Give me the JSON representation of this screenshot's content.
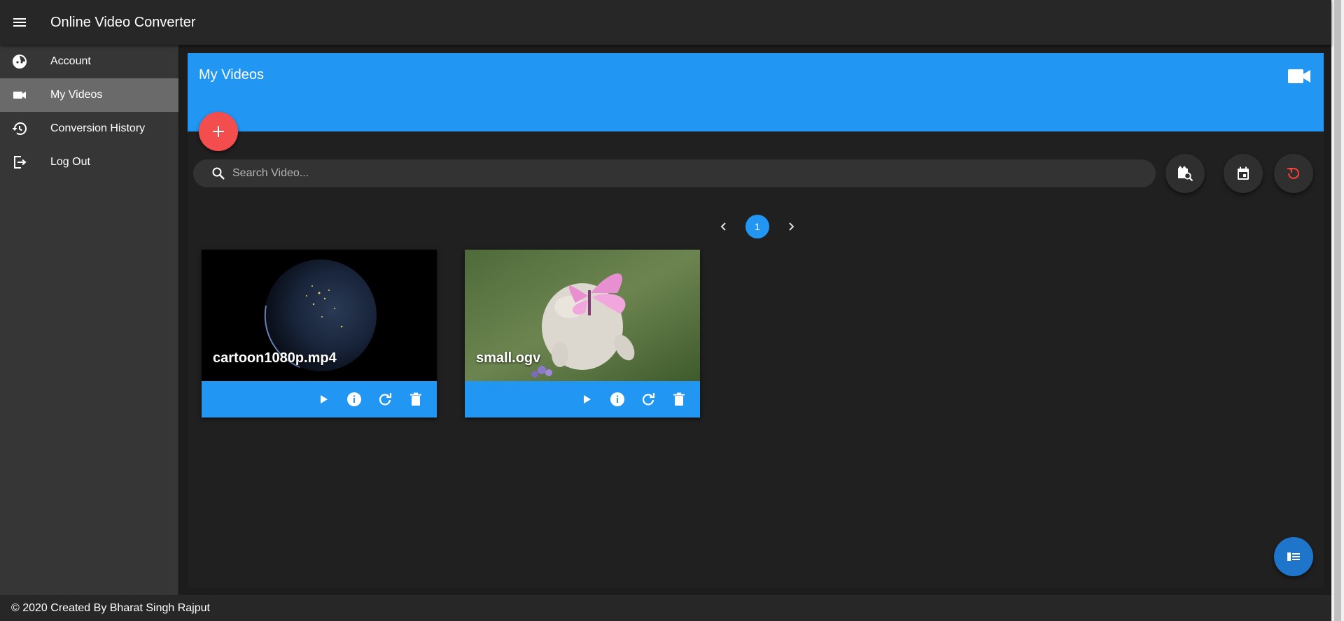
{
  "app": {
    "title": "Online Video Converter"
  },
  "sidebar": {
    "items": [
      {
        "label": "Account",
        "icon": "account-face-icon",
        "active": false
      },
      {
        "label": "My Videos",
        "icon": "videocam-icon",
        "active": true
      },
      {
        "label": "Conversion History",
        "icon": "history-icon",
        "active": false
      },
      {
        "label": "Log Out",
        "icon": "logout-icon",
        "active": false
      }
    ]
  },
  "main": {
    "title": "My Videos",
    "search": {
      "placeholder": "Search Video...",
      "value": ""
    },
    "pagination": {
      "current_page": "1"
    },
    "videos": [
      {
        "name": "cartoon1080p.mp4",
        "thumbnail": "earth-at-night-thumbnail"
      },
      {
        "name": "small.ogv",
        "thumbnail": "bunny-with-butterfly-thumbnail"
      }
    ]
  },
  "colors": {
    "accent": "#2196f3",
    "fab_add": "#f44d4d",
    "refresh_icon": "#f44336",
    "appbar": "#272727",
    "sidebar": "#363636",
    "sidebar_active": "#6a6a6a"
  },
  "footer": {
    "text": "© 2020 Created By Bharat Singh Rajput"
  }
}
